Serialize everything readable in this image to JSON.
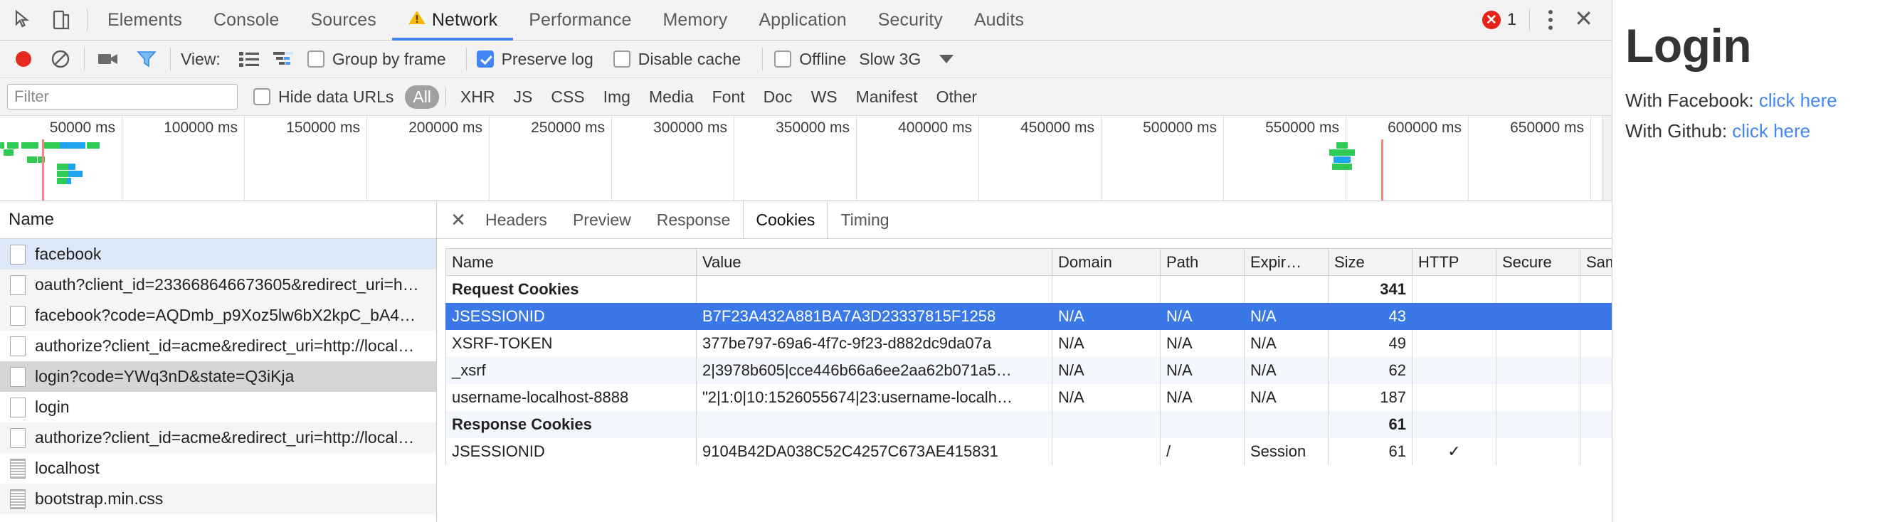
{
  "devtools": {
    "tabs": [
      {
        "label": "Elements",
        "selected": false,
        "warn": false
      },
      {
        "label": "Console",
        "selected": false,
        "warn": false
      },
      {
        "label": "Sources",
        "selected": false,
        "warn": false
      },
      {
        "label": "Network",
        "selected": true,
        "warn": true
      },
      {
        "label": "Performance",
        "selected": false,
        "warn": false
      },
      {
        "label": "Memory",
        "selected": false,
        "warn": false
      },
      {
        "label": "Application",
        "selected": false,
        "warn": false
      },
      {
        "label": "Security",
        "selected": false,
        "warn": false
      },
      {
        "label": "Audits",
        "selected": false,
        "warn": false
      }
    ],
    "error_count": "1",
    "icons": {
      "inspect": "inspect-element-icon",
      "device": "device-toolbar-icon",
      "record": "record-icon",
      "clear": "clear-icon",
      "camera": "screenshot-capture-icon",
      "filter": "filter-funnel-icon",
      "more": "more-options-icon",
      "close": "close-panel-icon"
    },
    "controls": {
      "view_label": "View:",
      "group_by_frame": {
        "label": "Group by frame",
        "checked": false
      },
      "preserve_log": {
        "label": "Preserve log",
        "checked": true
      },
      "disable_cache": {
        "label": "Disable cache",
        "checked": false
      },
      "offline": {
        "label": "Offline",
        "checked": false
      },
      "throttle": "Slow 3G"
    },
    "filterbar": {
      "filter_placeholder": "Filter",
      "filter_value": "",
      "hide_data_urls": {
        "label": "Hide data URLs",
        "checked": false
      },
      "types": [
        "All",
        "XHR",
        "JS",
        "CSS",
        "Img",
        "Media",
        "Font",
        "Doc",
        "WS",
        "Manifest",
        "Other"
      ],
      "active_type": "All"
    },
    "timeline": {
      "ticks": [
        "50000 ms",
        "100000 ms",
        "150000 ms",
        "200000 ms",
        "250000 ms",
        "300000 ms",
        "350000 ms",
        "400000 ms",
        "450000 ms",
        "500000 ms",
        "550000 ms",
        "600000 ms",
        "650000 ms"
      ]
    },
    "requests": {
      "column_header": "Name",
      "rows": [
        {
          "name": "facebook",
          "icon": "blank-doc-icon",
          "state": "selected-blue"
        },
        {
          "name": "oauth?client_id=233668646673605&redirect_uri=h…",
          "icon": "blank-doc-icon",
          "state": "odd"
        },
        {
          "name": "facebook?code=AQDmb_p9Xoz5lw6bX2kpC_bA4…",
          "icon": "blank-doc-icon",
          "state": "odd"
        },
        {
          "name": "authorize?client_id=acme&redirect_uri=http://local…",
          "icon": "blank-doc-icon",
          "state": "even"
        },
        {
          "name": "login?code=YWq3nD&state=Q3iKja",
          "icon": "blank-doc-icon",
          "state": "selected-grey"
        },
        {
          "name": "login",
          "icon": "blank-doc-icon",
          "state": "even"
        },
        {
          "name": "authorize?client_id=acme&redirect_uri=http://local…",
          "icon": "blank-doc-icon",
          "state": "odd"
        },
        {
          "name": "localhost",
          "icon": "doc-icon",
          "state": "even"
        },
        {
          "name": "bootstrap.min.css",
          "icon": "doc-icon",
          "state": "odd"
        }
      ]
    },
    "detail": {
      "tabs": [
        "Headers",
        "Preview",
        "Response",
        "Cookies",
        "Timing"
      ],
      "selected_tab": "Cookies",
      "close_label": "✕",
      "cookies": {
        "columns": [
          "Name",
          "Value",
          "Domain",
          "Path",
          "Expir…",
          "Size",
          "HTTP",
          "Secure",
          "Same…"
        ],
        "rows": [
          {
            "type": "group",
            "name": "Request Cookies",
            "value": "",
            "domain": "",
            "path": "",
            "expires": "",
            "size": "341",
            "http": "",
            "secure": "",
            "samesite": ""
          },
          {
            "type": "selected",
            "name": "JSESSIONID",
            "value": "B7F23A432A881BA7A3D23337815F1258",
            "domain": "N/A",
            "path": "N/A",
            "expires": "N/A",
            "size": "43",
            "http": "",
            "secure": "",
            "samesite": ""
          },
          {
            "type": "normal",
            "name": "XSRF-TOKEN",
            "value": "377be797-69a6-4f7c-9f23-d882dc9da07a",
            "domain": "N/A",
            "path": "N/A",
            "expires": "N/A",
            "size": "49",
            "http": "",
            "secure": "",
            "samesite": ""
          },
          {
            "type": "alt",
            "name": "_xsrf",
            "value": "2|3978b605|cce446b66a6ee2aa62b071a5…",
            "domain": "N/A",
            "path": "N/A",
            "expires": "N/A",
            "size": "62",
            "http": "",
            "secure": "",
            "samesite": ""
          },
          {
            "type": "normal",
            "name": "username-localhost-8888",
            "value": "\"2|1:0|10:1526055674|23:username-localh…",
            "domain": "N/A",
            "path": "N/A",
            "expires": "N/A",
            "size": "187",
            "http": "",
            "secure": "",
            "samesite": ""
          },
          {
            "type": "group-alt",
            "name": "Response Cookies",
            "value": "",
            "domain": "",
            "path": "",
            "expires": "",
            "size": "61",
            "http": "",
            "secure": "",
            "samesite": ""
          },
          {
            "type": "normal",
            "name": "JSESSIONID",
            "value": "9104B42DA038C52C4257C673AE415831",
            "domain": "",
            "path": "/",
            "expires": "Session",
            "size": "61",
            "http": "✓",
            "secure": "",
            "samesite": ""
          }
        ]
      }
    }
  },
  "page": {
    "title": "Login",
    "facebook_label": "With Facebook:",
    "facebook_link": "click here",
    "github_label": "With Github:",
    "github_link": "click here"
  },
  "colors": {
    "accent": "#4285f4",
    "selection": "#3b78e7",
    "error": "#e62117",
    "link": "#4286f5",
    "wf_green": "#2ecc55",
    "wf_blue": "#1ea3f0",
    "redline": "#ff8080"
  }
}
